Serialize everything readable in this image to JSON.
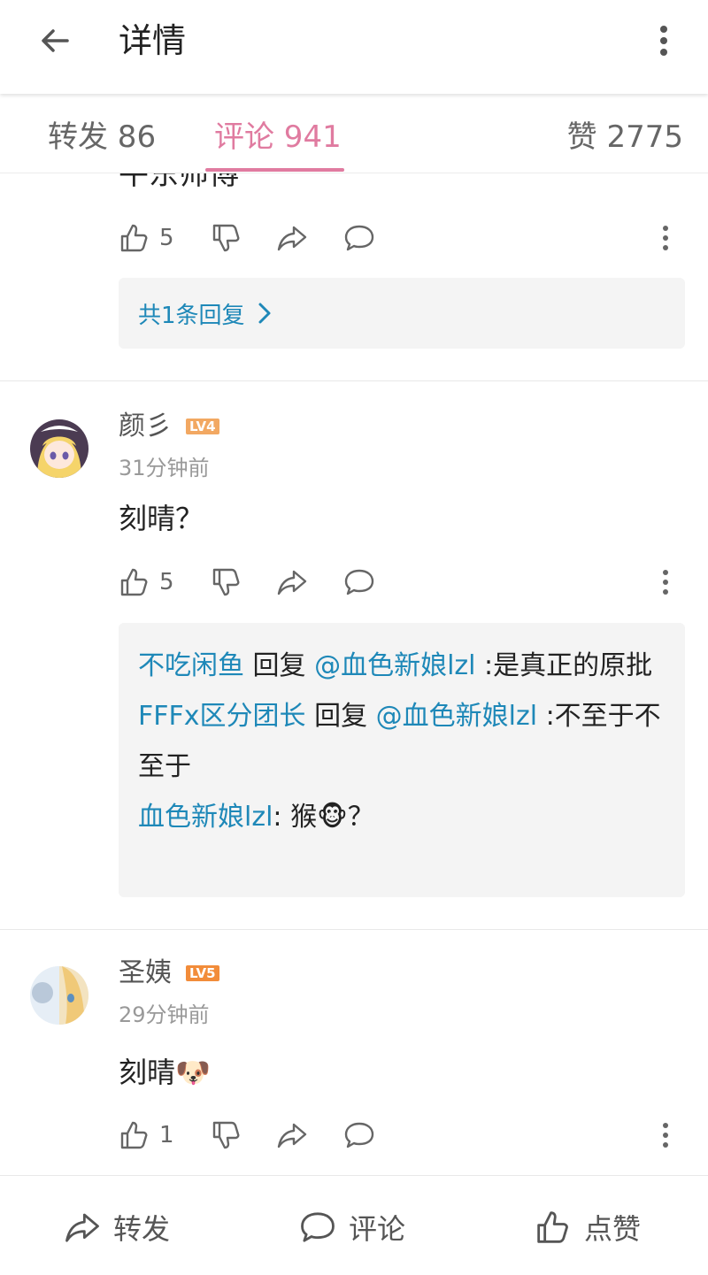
{
  "header": {
    "title": "详情",
    "back_icon": "arrow-left-icon",
    "more_icon": "more-vertical-icon"
  },
  "tabs": {
    "repost": "转发 86",
    "comment": "评论 941",
    "like": "赞 2775",
    "active_color": "#e07ba0"
  },
  "partial_comment": {
    "text_fragment": "牛东师傅",
    "actions": {
      "like_count": "5"
    },
    "reply_summary": "共1条回复"
  },
  "comments": [
    {
      "username": "颜彡",
      "level": "LV4",
      "level_color": "#f2a862",
      "time": "31分钟前",
      "text": "刻晴？",
      "actions": {
        "like_count": "5"
      },
      "replies": [
        {
          "user": "不吃闲鱼",
          "verb": " 回复 ",
          "target": "@血色新娘lzl",
          "text": " :是真正的原批"
        },
        {
          "user": "FFFx区分团长",
          "verb": " 回复 ",
          "target": "@血色新娘lzl",
          "text": " :不至于不至于"
        },
        {
          "user": "血色新娘lzl",
          "verb": "",
          "target": "",
          "text": ": 猴🐵？"
        }
      ]
    },
    {
      "username": "圣姨",
      "level": "LV5",
      "level_color": "#f28c3a",
      "time": "29分钟前",
      "text": "刻晴🐶",
      "actions": {
        "like_count": "1"
      }
    }
  ],
  "bottom_bar": {
    "repost": "转发",
    "comment": "评论",
    "like": "点赞"
  },
  "colors": {
    "link": "#1e88b8",
    "reply_bg": "#f4f4f4"
  }
}
